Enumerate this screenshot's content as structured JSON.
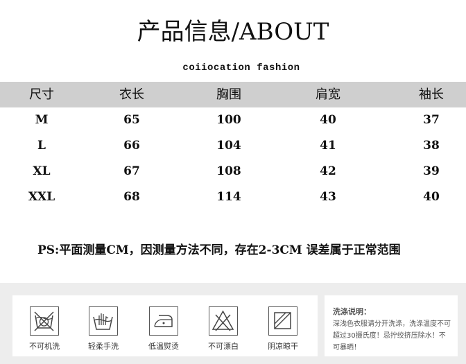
{
  "header": {
    "title": "产品信息/ABOUT",
    "subtitle": "coiiocation fashion"
  },
  "table": {
    "headers": [
      "尺寸",
      "衣长",
      "胸围",
      "肩宽",
      "袖长"
    ],
    "rows": [
      [
        "M",
        "65",
        "100",
        "40",
        "37"
      ],
      [
        "L",
        "66",
        "104",
        "41",
        "38"
      ],
      [
        "XL",
        "67",
        "108",
        "42",
        "39"
      ],
      [
        "XXL",
        "68",
        "114",
        "43",
        "40"
      ]
    ]
  },
  "note": "PS:平面测量CM，因测量方法不同，存在2-3CM 误差属于正常范围",
  "care": {
    "items": [
      {
        "label": "不可机洗",
        "icon": "no-machine-wash-icon"
      },
      {
        "label": "轻柔手洗",
        "icon": "hand-wash-icon"
      },
      {
        "label": "低温熨烫",
        "icon": "low-iron-icon"
      },
      {
        "label": "不可漂白",
        "icon": "no-bleach-icon"
      },
      {
        "label": "阴凉晾干",
        "icon": "shade-dry-icon"
      }
    ],
    "notes_title": "洗涤说明：",
    "notes_text": "深浅色衣服请分开洗涤，洗涤温度不可超过30摄氏度！忌拧绞挤压除水！不可暴晒！"
  }
}
